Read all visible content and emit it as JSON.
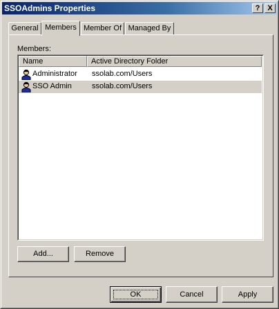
{
  "window": {
    "title": "SSOAdmins Properties",
    "help_glyph": "?",
    "close_glyph": "X"
  },
  "tabs": [
    {
      "label": "General",
      "active": false
    },
    {
      "label": "Members",
      "active": true
    },
    {
      "label": "Member Of",
      "active": false
    },
    {
      "label": "Managed By",
      "active": false
    }
  ],
  "members": {
    "label": "Members:",
    "columns": [
      "Name",
      "Active Directory Folder"
    ],
    "rows": [
      {
        "name": "Administrator",
        "folder": "ssolab.com/Users",
        "selected": false,
        "icon": "user-icon"
      },
      {
        "name": "SSO Admin",
        "folder": "ssolab.com/Users",
        "selected": true,
        "icon": "user-icon"
      }
    ]
  },
  "actions": {
    "add_label": "Add...",
    "remove_label": "Remove"
  },
  "footer": {
    "ok_label": "OK",
    "cancel_label": "Cancel",
    "apply_label": "Apply"
  }
}
